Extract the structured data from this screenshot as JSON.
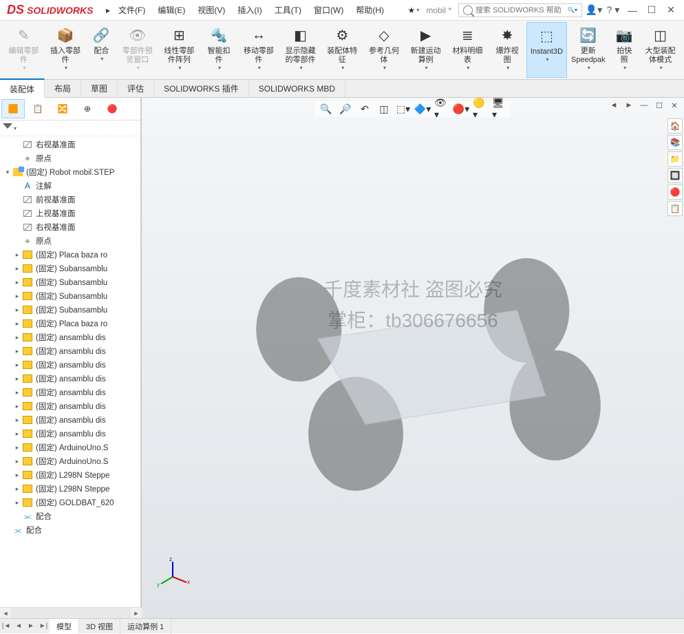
{
  "app": {
    "logo": "SOLIDWORKS"
  },
  "menus": [
    "文件(F)",
    "编辑(E)",
    "视图(V)",
    "插入(I)",
    "工具(T)",
    "窗口(W)",
    "帮助(H)"
  ],
  "doc_name": "mobil *",
  "search": {
    "placeholder": "搜索 SOLIDWORKS 帮助"
  },
  "ribbon": [
    {
      "label": "编辑零部件",
      "icon": "✎",
      "dim": true
    },
    {
      "label": "插入零部件",
      "icon": "📦"
    },
    {
      "label": "配合",
      "icon": "🔗"
    },
    {
      "label": "零部件预览窗口",
      "icon": "👁",
      "dim": true
    },
    {
      "label": "线性零部件阵列",
      "icon": "⊞"
    },
    {
      "label": "智能扣件",
      "icon": "🔩"
    },
    {
      "label": "移动零部件",
      "icon": "↔"
    },
    {
      "label": "显示隐藏的零部件",
      "icon": "◧"
    },
    {
      "label": "装配体特征",
      "icon": "⚙"
    },
    {
      "label": "参考几何体",
      "icon": "◇"
    },
    {
      "label": "新建运动算例",
      "icon": "▶"
    },
    {
      "label": "材料明细表",
      "icon": "≣"
    },
    {
      "label": "爆炸视图",
      "icon": "✸"
    },
    {
      "label": "Instant3D",
      "icon": "⬚",
      "hl": true
    },
    {
      "label": "更新 Speedpak",
      "icon": "🔄"
    },
    {
      "label": "拍快照",
      "icon": "📷"
    },
    {
      "label": "大型装配体模式",
      "icon": "◫"
    }
  ],
  "tabs": [
    "装配体",
    "布局",
    "草图",
    "评估",
    "SOLIDWORKS 插件",
    "SOLIDWORKS MBD"
  ],
  "active_tab": 0,
  "tree": [
    {
      "ind": 1,
      "icon": "plane",
      "label": "右视基准面"
    },
    {
      "ind": 1,
      "icon": "origin",
      "label": "原点"
    },
    {
      "ind": 0,
      "exp": "▾",
      "icon": "assy",
      "label": "(固定) Robot mobil.STEP"
    },
    {
      "ind": 1,
      "icon": "anno",
      "label": "注解"
    },
    {
      "ind": 1,
      "icon": "plane",
      "label": "前视基准面"
    },
    {
      "ind": 1,
      "icon": "plane",
      "label": "上视基准面"
    },
    {
      "ind": 1,
      "icon": "plane",
      "label": "右视基准面"
    },
    {
      "ind": 1,
      "icon": "origin",
      "label": "原点"
    },
    {
      "ind": 1,
      "exp": "▸",
      "icon": "part",
      "label": "(固定) Placa baza ro"
    },
    {
      "ind": 1,
      "exp": "▸",
      "icon": "part",
      "label": "(固定) Subansamblu"
    },
    {
      "ind": 1,
      "exp": "▸",
      "icon": "part",
      "label": "(固定) Subansamblu"
    },
    {
      "ind": 1,
      "exp": "▸",
      "icon": "part",
      "label": "(固定) Subansamblu"
    },
    {
      "ind": 1,
      "exp": "▸",
      "icon": "part",
      "label": "(固定) Subansamblu"
    },
    {
      "ind": 1,
      "exp": "▸",
      "icon": "part",
      "label": "(固定) Placa baza ro"
    },
    {
      "ind": 1,
      "exp": "▸",
      "icon": "part",
      "label": "(固定) ansamblu dis"
    },
    {
      "ind": 1,
      "exp": "▸",
      "icon": "part",
      "label": "(固定) ansamblu dis"
    },
    {
      "ind": 1,
      "exp": "▸",
      "icon": "part",
      "label": "(固定) ansamblu dis"
    },
    {
      "ind": 1,
      "exp": "▸",
      "icon": "part",
      "label": "(固定) ansamblu dis"
    },
    {
      "ind": 1,
      "exp": "▸",
      "icon": "part",
      "label": "(固定) ansamblu dis"
    },
    {
      "ind": 1,
      "exp": "▸",
      "icon": "part",
      "label": "(固定) ansamblu dis"
    },
    {
      "ind": 1,
      "exp": "▸",
      "icon": "part",
      "label": "(固定) ansamblu dis"
    },
    {
      "ind": 1,
      "exp": "▸",
      "icon": "part",
      "label": "(固定) ansamblu dis"
    },
    {
      "ind": 1,
      "exp": "▸",
      "icon": "part",
      "label": "(固定) ArduinoUno.S"
    },
    {
      "ind": 1,
      "exp": "▸",
      "icon": "part",
      "label": "(固定) ArduinoUno.S"
    },
    {
      "ind": 1,
      "exp": "▸",
      "icon": "part",
      "label": "(固定) L298N Steppe"
    },
    {
      "ind": 1,
      "exp": "▸",
      "icon": "part",
      "label": "(固定) L298N Steppe"
    },
    {
      "ind": 1,
      "exp": "▸",
      "icon": "part",
      "label": "(固定) GOLDBAT_620"
    },
    {
      "ind": 1,
      "icon": "mate",
      "label": "配合"
    },
    {
      "ind": 0,
      "icon": "mate",
      "label": "配合"
    }
  ],
  "bottom_tabs": [
    "模型",
    "3D 视图",
    "运动算例 1"
  ],
  "watermark": {
    "line1": "千度素材社 盗图必究",
    "line2": "掌柜：tb306676656"
  }
}
